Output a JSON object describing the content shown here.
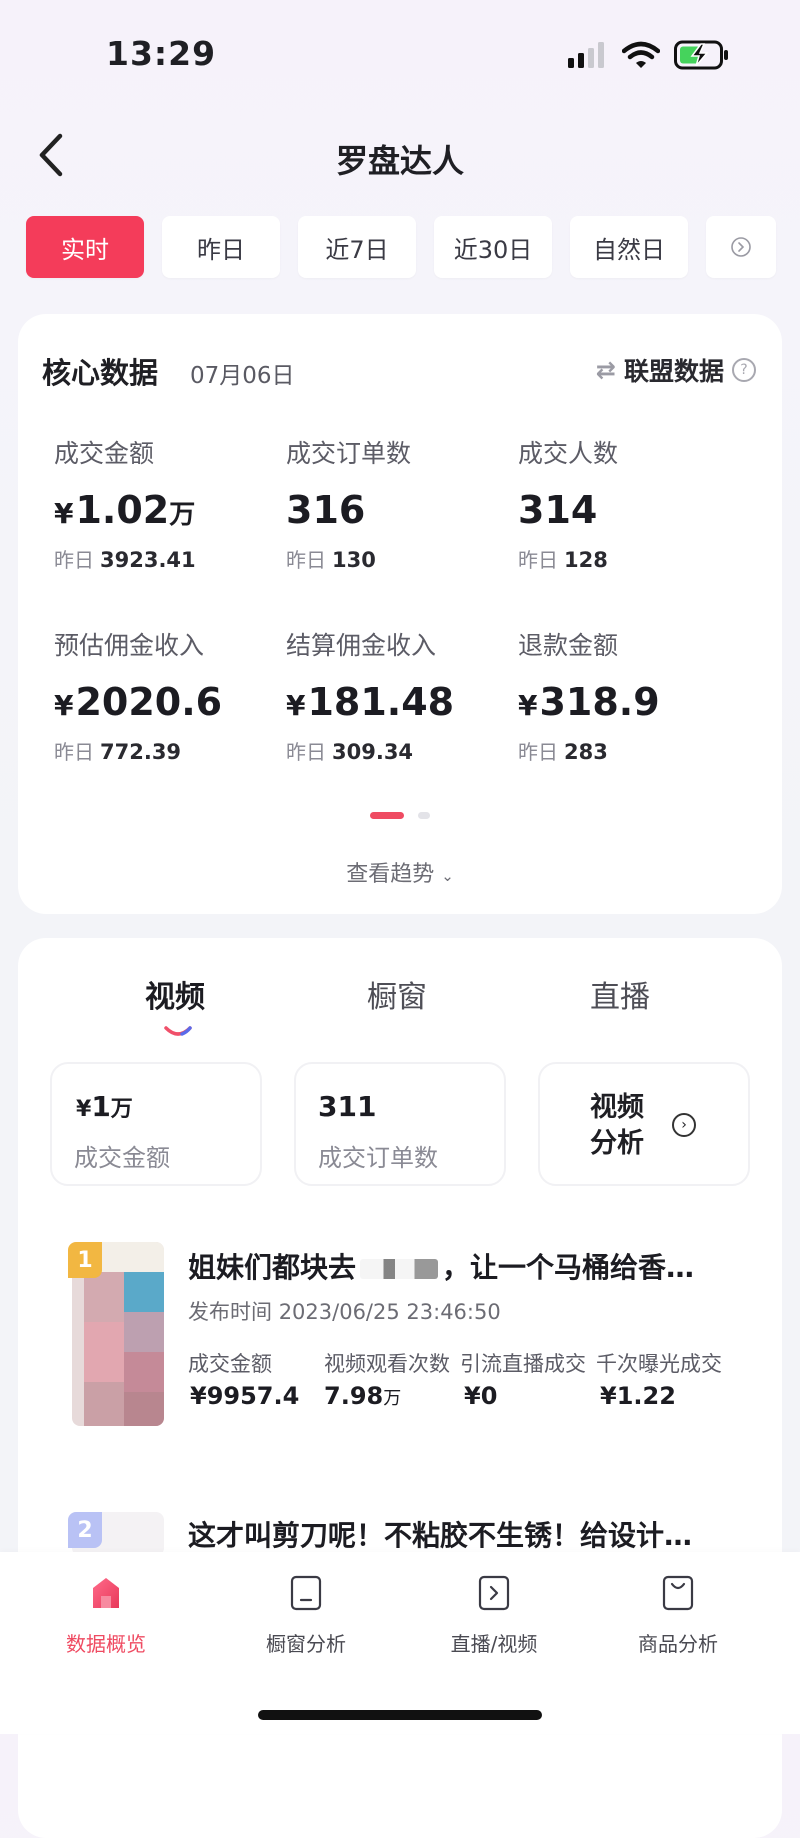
{
  "status": {
    "time": "13:29"
  },
  "nav": {
    "title": "罗盘达人"
  },
  "tabs": [
    {
      "label": "实时",
      "active": true
    },
    {
      "label": "昨日"
    },
    {
      "label": "近7日"
    },
    {
      "label": "近30日"
    },
    {
      "label": "自然日"
    }
  ],
  "core": {
    "title": "核心数据",
    "date": "07月06日",
    "alliance_label": "联盟数据",
    "yesterday_label": "昨日",
    "metrics": [
      {
        "label": "成交金额",
        "prefix": "¥",
        "value": "1.02",
        "unit": "万",
        "yesterday": "3923.41"
      },
      {
        "label": "成交订单数",
        "prefix": "",
        "value": "316",
        "unit": "",
        "yesterday": "130"
      },
      {
        "label": "成交人数",
        "prefix": "",
        "value": "314",
        "unit": "",
        "yesterday": "128"
      },
      {
        "label": "预估佣金收入",
        "prefix": "¥",
        "value": "2020.6",
        "unit": "",
        "yesterday": "772.39"
      },
      {
        "label": "结算佣金收入",
        "prefix": "¥",
        "value": "181.48",
        "unit": "",
        "yesterday": "309.34"
      },
      {
        "label": "退款金额",
        "prefix": "¥",
        "value": "318.9",
        "unit": "",
        "yesterday": "283"
      }
    ],
    "trend_link": "查看趋势",
    "page_indicator": {
      "current": 1,
      "total": 2
    }
  },
  "content_tabs": [
    {
      "label": "视频",
      "active": true
    },
    {
      "label": "橱窗"
    },
    {
      "label": "直播"
    }
  ],
  "summary": {
    "amount_prefix": "¥",
    "amount_value": "1",
    "amount_unit": "万",
    "amount_label": "成交金额",
    "orders_value": "311",
    "orders_label": "成交订单数",
    "analysis_label": "视频分析"
  },
  "videos": [
    {
      "rank": "1",
      "title": "姐妹们都块去",
      "title_tail": "，让一个马桶给香…",
      "publish_label": "发布时间",
      "publish_time": "2023/06/25 23:46:50",
      "labels": [
        "成交金额",
        "视频观看次数",
        "引流直播成交",
        "千次曝光成交"
      ],
      "values": [
        "¥9957.4",
        "7.98",
        "¥0",
        "¥1.22"
      ],
      "value_units": [
        "",
        "万",
        "",
        ""
      ]
    },
    {
      "rank": "2",
      "title": "这才叫剪刀呢！不粘胶不生锈！给设计…"
    }
  ],
  "bottom_nav": [
    {
      "label": "数据概览",
      "icon": "home-icon",
      "active": true
    },
    {
      "label": "橱窗分析",
      "icon": "showcase-icon"
    },
    {
      "label": "直播/视频",
      "icon": "play-icon"
    },
    {
      "label": "商品分析",
      "icon": "bag-icon"
    }
  ],
  "colors": {
    "accent": "#f43c5a",
    "rank1": "#f2b742",
    "rank2": "#b9c2f5"
  }
}
